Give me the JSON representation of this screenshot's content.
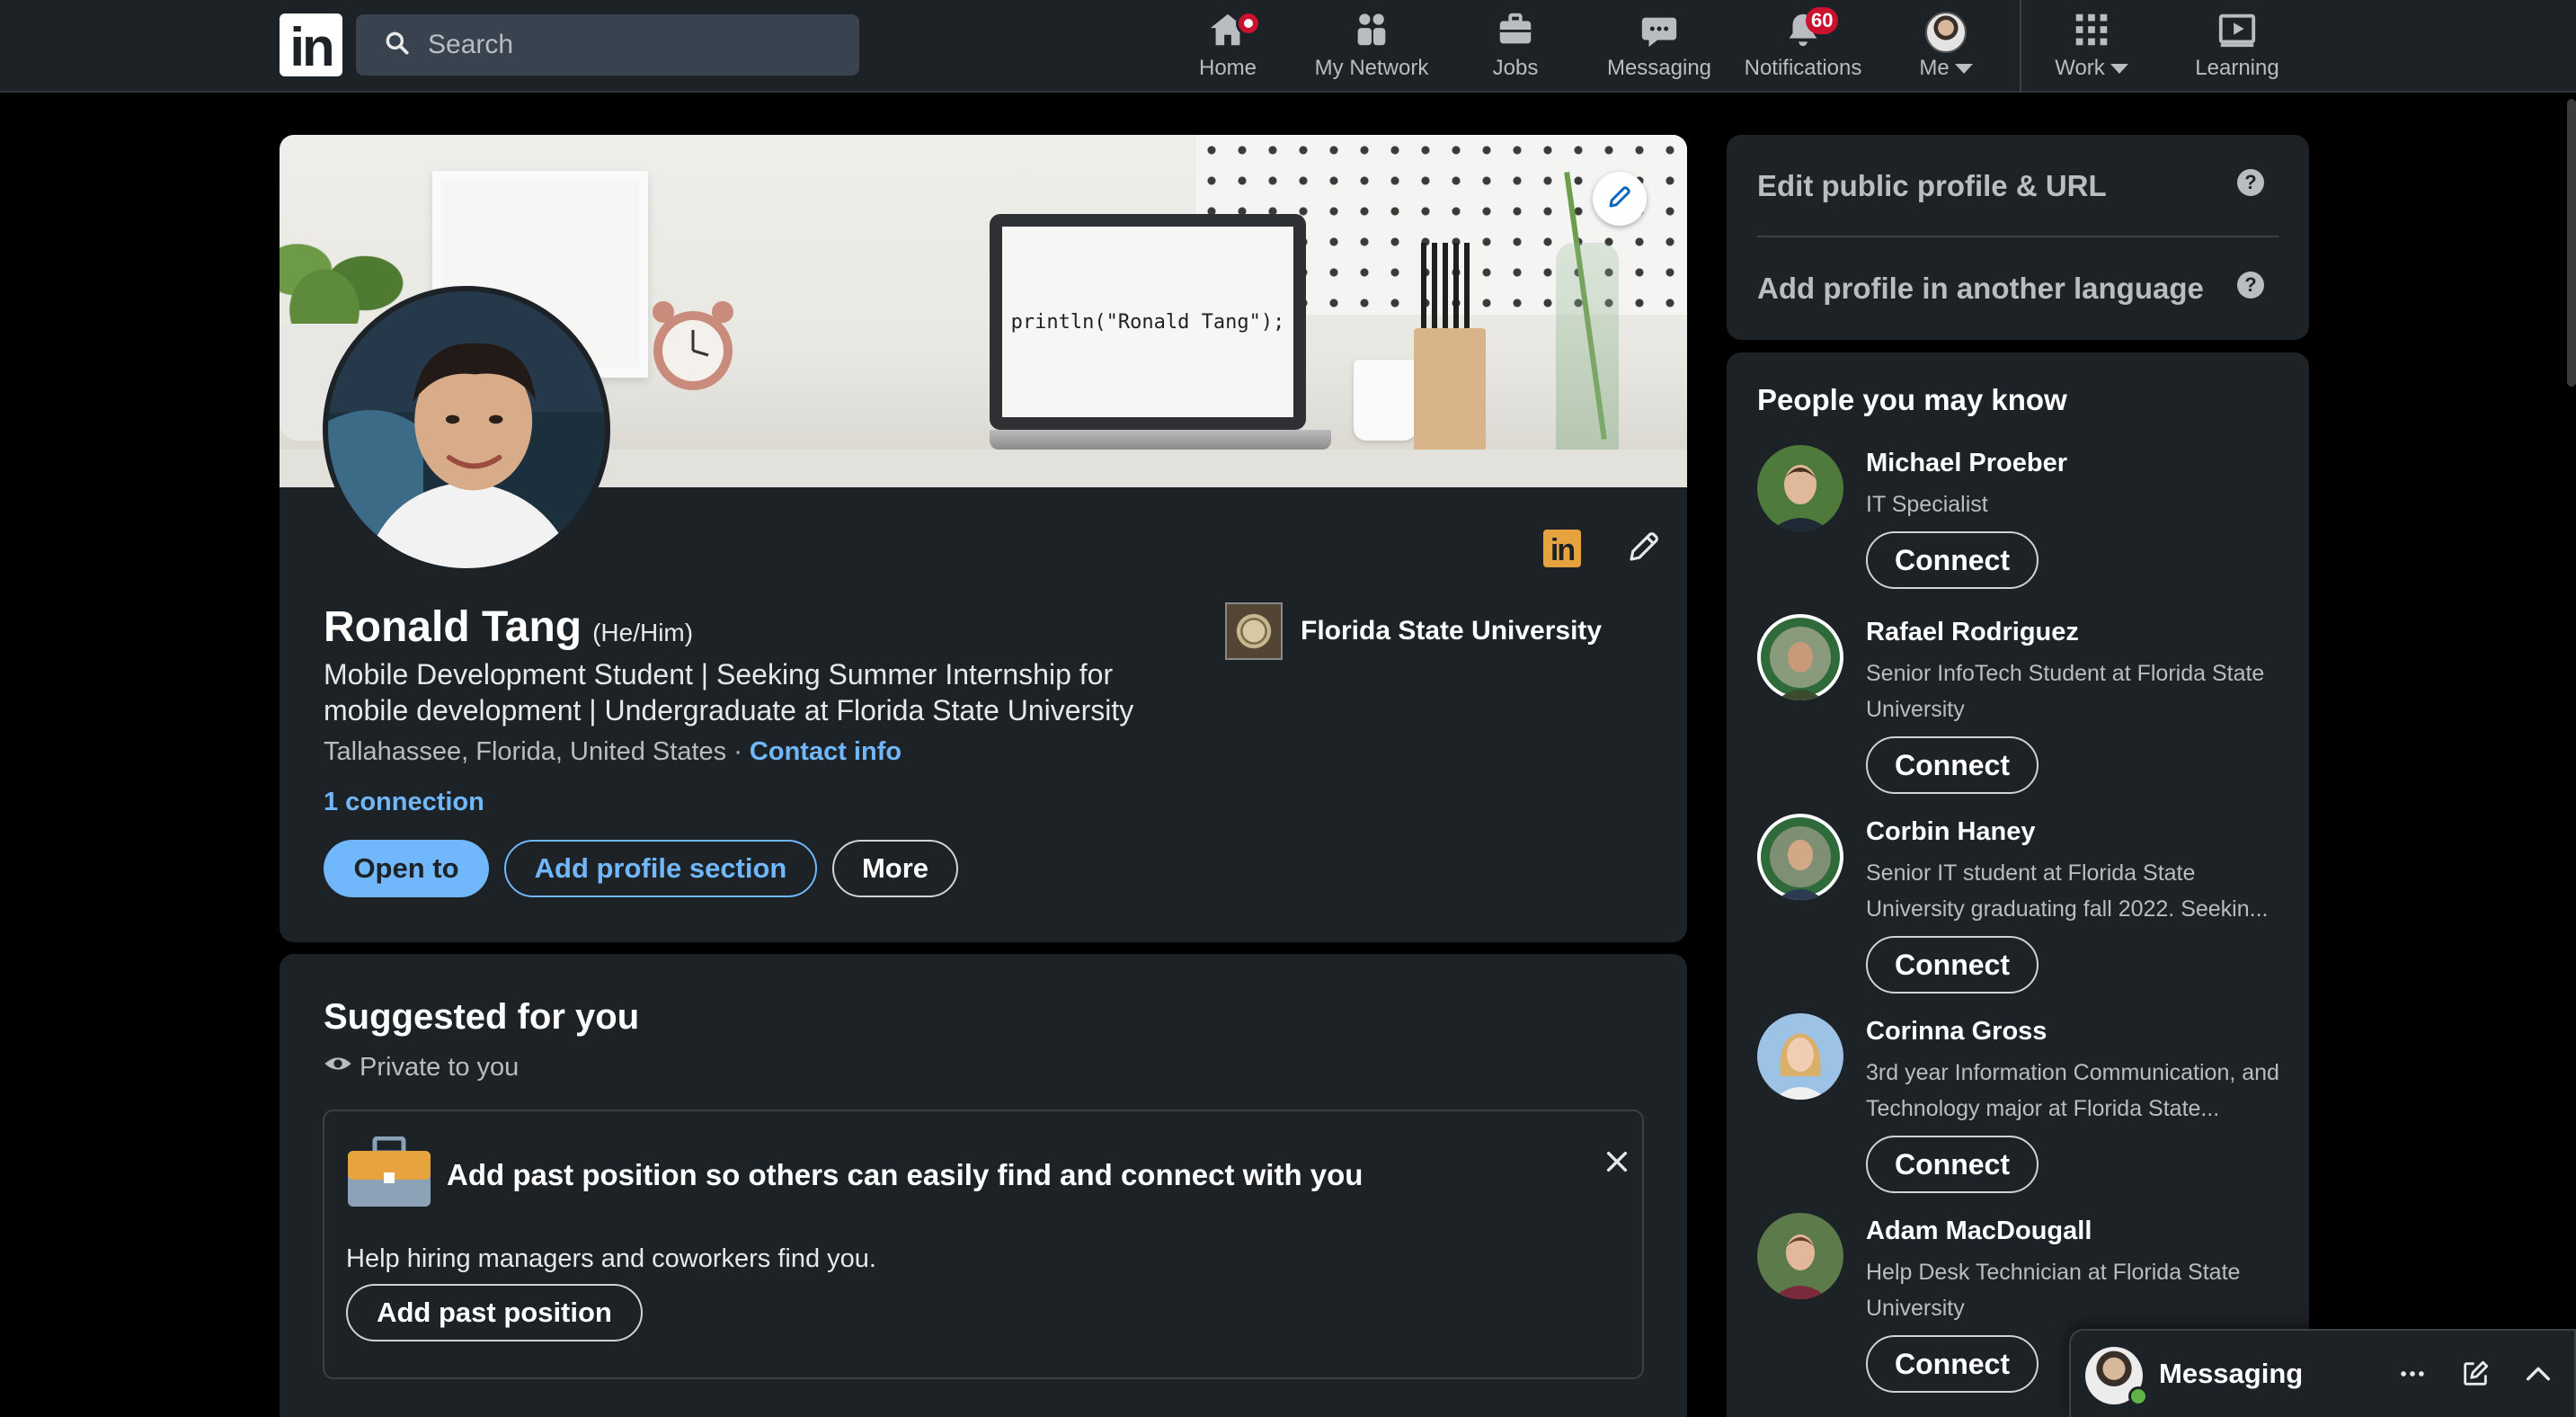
{
  "nav": {
    "logo": "in",
    "search_placeholder": "Search",
    "items": [
      {
        "label": "Home",
        "icon": "home-icon"
      },
      {
        "label": "My Network",
        "icon": "network-icon"
      },
      {
        "label": "Jobs",
        "icon": "jobs-icon"
      },
      {
        "label": "Messaging",
        "icon": "messaging-icon"
      },
      {
        "label": "Notifications",
        "icon": "bell-icon",
        "badge": "60"
      },
      {
        "label": "Me",
        "icon": "avatar"
      },
      {
        "label": "Work",
        "icon": "grid-icon"
      },
      {
        "label": "Learning",
        "icon": "learning-icon"
      }
    ]
  },
  "profile": {
    "cover_code": "println(\"Ronald Tang\");",
    "name": "Ronald Tang",
    "pronouns": "(He/Him)",
    "headline": "Mobile Development Student | Seeking Summer Internship for mobile development | Undergraduate at Florida State University",
    "location": "Tallahassee, Florida, United States",
    "separator": " · ",
    "contact_info": "Contact info",
    "connections": "1 connection",
    "education": "Florida State University",
    "buttons": {
      "open_to": "Open to",
      "add_section": "Add profile section",
      "more": "More"
    }
  },
  "suggested": {
    "title": "Suggested for you",
    "privacy": "Private to you",
    "box_title": "Add past position so others can easily find and connect with you",
    "box_desc": "Help hiring managers and coworkers find you.",
    "button": "Add past position"
  },
  "rail": {
    "edit_public": "Edit public profile & URL",
    "add_language": "Add profile in another language",
    "help_glyph": "?",
    "people_title": "People you may know",
    "people": [
      {
        "name": "Michael Proeber",
        "sub": "IT Specialist",
        "action": "Connect"
      },
      {
        "name": "Rafael Rodriguez",
        "sub": "Senior InfoTech Student at Florida State University",
        "action": "Connect"
      },
      {
        "name": "Corbin Haney",
        "sub": "Senior IT student at Florida State University graduating fall 2022. Seekin...",
        "action": "Connect"
      },
      {
        "name": "Corinna Gross",
        "sub": "3rd year Information Communication, and Technology major at Florida State...",
        "action": "Connect"
      },
      {
        "name": "Adam MacDougall",
        "sub": "Help Desk Technician at Florida State University",
        "action": "Connect"
      }
    ]
  },
  "messaging_dock": {
    "label": "Messaging"
  },
  "colors": {
    "background": "#000000",
    "card": "#1d2226",
    "accent_blue": "#71b7fb",
    "badge_red": "#cb112d"
  }
}
